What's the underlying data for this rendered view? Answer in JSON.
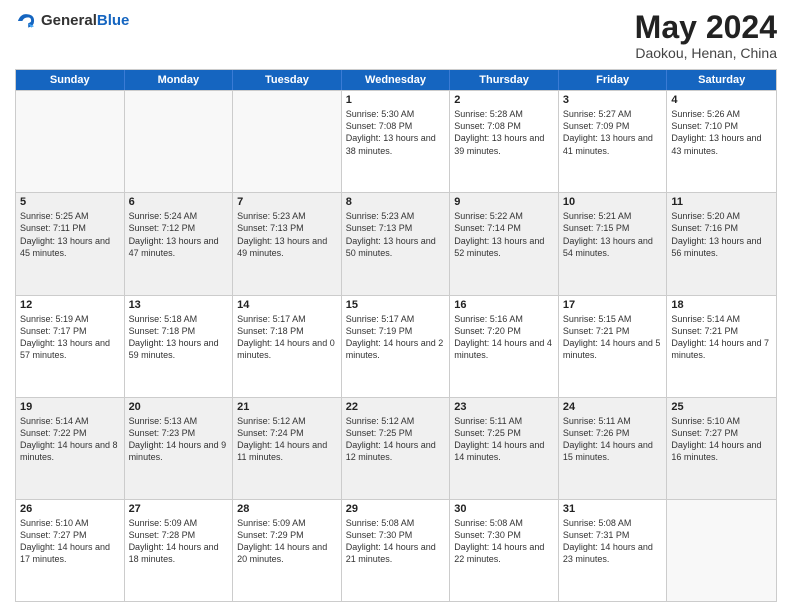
{
  "logo": {
    "general": "General",
    "blue": "Blue"
  },
  "title": "May 2024",
  "location": "Daokou, Henan, China",
  "days": [
    "Sunday",
    "Monday",
    "Tuesday",
    "Wednesday",
    "Thursday",
    "Friday",
    "Saturday"
  ],
  "weeks": [
    [
      {
        "day": "",
        "sunrise": "",
        "sunset": "",
        "daylight": "",
        "empty": true
      },
      {
        "day": "",
        "sunrise": "",
        "sunset": "",
        "daylight": "",
        "empty": true
      },
      {
        "day": "",
        "sunrise": "",
        "sunset": "",
        "daylight": "",
        "empty": true
      },
      {
        "day": "1",
        "sunrise": "Sunrise: 5:30 AM",
        "sunset": "Sunset: 7:08 PM",
        "daylight": "Daylight: 13 hours and 38 minutes."
      },
      {
        "day": "2",
        "sunrise": "Sunrise: 5:28 AM",
        "sunset": "Sunset: 7:08 PM",
        "daylight": "Daylight: 13 hours and 39 minutes."
      },
      {
        "day": "3",
        "sunrise": "Sunrise: 5:27 AM",
        "sunset": "Sunset: 7:09 PM",
        "daylight": "Daylight: 13 hours and 41 minutes."
      },
      {
        "day": "4",
        "sunrise": "Sunrise: 5:26 AM",
        "sunset": "Sunset: 7:10 PM",
        "daylight": "Daylight: 13 hours and 43 minutes."
      }
    ],
    [
      {
        "day": "5",
        "sunrise": "Sunrise: 5:25 AM",
        "sunset": "Sunset: 7:11 PM",
        "daylight": "Daylight: 13 hours and 45 minutes."
      },
      {
        "day": "6",
        "sunrise": "Sunrise: 5:24 AM",
        "sunset": "Sunset: 7:12 PM",
        "daylight": "Daylight: 13 hours and 47 minutes."
      },
      {
        "day": "7",
        "sunrise": "Sunrise: 5:23 AM",
        "sunset": "Sunset: 7:13 PM",
        "daylight": "Daylight: 13 hours and 49 minutes."
      },
      {
        "day": "8",
        "sunrise": "Sunrise: 5:23 AM",
        "sunset": "Sunset: 7:13 PM",
        "daylight": "Daylight: 13 hours and 50 minutes."
      },
      {
        "day": "9",
        "sunrise": "Sunrise: 5:22 AM",
        "sunset": "Sunset: 7:14 PM",
        "daylight": "Daylight: 13 hours and 52 minutes."
      },
      {
        "day": "10",
        "sunrise": "Sunrise: 5:21 AM",
        "sunset": "Sunset: 7:15 PM",
        "daylight": "Daylight: 13 hours and 54 minutes."
      },
      {
        "day": "11",
        "sunrise": "Sunrise: 5:20 AM",
        "sunset": "Sunset: 7:16 PM",
        "daylight": "Daylight: 13 hours and 56 minutes."
      }
    ],
    [
      {
        "day": "12",
        "sunrise": "Sunrise: 5:19 AM",
        "sunset": "Sunset: 7:17 PM",
        "daylight": "Daylight: 13 hours and 57 minutes."
      },
      {
        "day": "13",
        "sunrise": "Sunrise: 5:18 AM",
        "sunset": "Sunset: 7:18 PM",
        "daylight": "Daylight: 13 hours and 59 minutes."
      },
      {
        "day": "14",
        "sunrise": "Sunrise: 5:17 AM",
        "sunset": "Sunset: 7:18 PM",
        "daylight": "Daylight: 14 hours and 0 minutes."
      },
      {
        "day": "15",
        "sunrise": "Sunrise: 5:17 AM",
        "sunset": "Sunset: 7:19 PM",
        "daylight": "Daylight: 14 hours and 2 minutes."
      },
      {
        "day": "16",
        "sunrise": "Sunrise: 5:16 AM",
        "sunset": "Sunset: 7:20 PM",
        "daylight": "Daylight: 14 hours and 4 minutes."
      },
      {
        "day": "17",
        "sunrise": "Sunrise: 5:15 AM",
        "sunset": "Sunset: 7:21 PM",
        "daylight": "Daylight: 14 hours and 5 minutes."
      },
      {
        "day": "18",
        "sunrise": "Sunrise: 5:14 AM",
        "sunset": "Sunset: 7:21 PM",
        "daylight": "Daylight: 14 hours and 7 minutes."
      }
    ],
    [
      {
        "day": "19",
        "sunrise": "Sunrise: 5:14 AM",
        "sunset": "Sunset: 7:22 PM",
        "daylight": "Daylight: 14 hours and 8 minutes."
      },
      {
        "day": "20",
        "sunrise": "Sunrise: 5:13 AM",
        "sunset": "Sunset: 7:23 PM",
        "daylight": "Daylight: 14 hours and 9 minutes."
      },
      {
        "day": "21",
        "sunrise": "Sunrise: 5:12 AM",
        "sunset": "Sunset: 7:24 PM",
        "daylight": "Daylight: 14 hours and 11 minutes."
      },
      {
        "day": "22",
        "sunrise": "Sunrise: 5:12 AM",
        "sunset": "Sunset: 7:25 PM",
        "daylight": "Daylight: 14 hours and 12 minutes."
      },
      {
        "day": "23",
        "sunrise": "Sunrise: 5:11 AM",
        "sunset": "Sunset: 7:25 PM",
        "daylight": "Daylight: 14 hours and 14 minutes."
      },
      {
        "day": "24",
        "sunrise": "Sunrise: 5:11 AM",
        "sunset": "Sunset: 7:26 PM",
        "daylight": "Daylight: 14 hours and 15 minutes."
      },
      {
        "day": "25",
        "sunrise": "Sunrise: 5:10 AM",
        "sunset": "Sunset: 7:27 PM",
        "daylight": "Daylight: 14 hours and 16 minutes."
      }
    ],
    [
      {
        "day": "26",
        "sunrise": "Sunrise: 5:10 AM",
        "sunset": "Sunset: 7:27 PM",
        "daylight": "Daylight: 14 hours and 17 minutes."
      },
      {
        "day": "27",
        "sunrise": "Sunrise: 5:09 AM",
        "sunset": "Sunset: 7:28 PM",
        "daylight": "Daylight: 14 hours and 18 minutes."
      },
      {
        "day": "28",
        "sunrise": "Sunrise: 5:09 AM",
        "sunset": "Sunset: 7:29 PM",
        "daylight": "Daylight: 14 hours and 20 minutes."
      },
      {
        "day": "29",
        "sunrise": "Sunrise: 5:08 AM",
        "sunset": "Sunset: 7:30 PM",
        "daylight": "Daylight: 14 hours and 21 minutes."
      },
      {
        "day": "30",
        "sunrise": "Sunrise: 5:08 AM",
        "sunset": "Sunset: 7:30 PM",
        "daylight": "Daylight: 14 hours and 22 minutes."
      },
      {
        "day": "31",
        "sunrise": "Sunrise: 5:08 AM",
        "sunset": "Sunset: 7:31 PM",
        "daylight": "Daylight: 14 hours and 23 minutes."
      },
      {
        "day": "",
        "sunrise": "",
        "sunset": "",
        "daylight": "",
        "empty": true
      }
    ]
  ]
}
